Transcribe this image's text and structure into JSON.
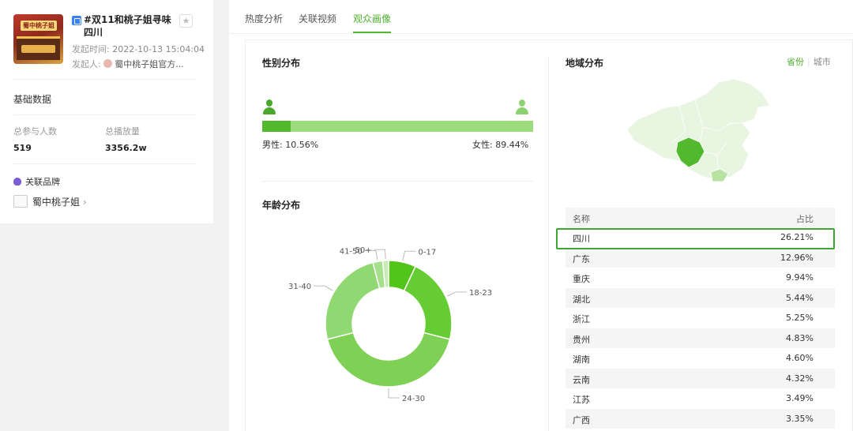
{
  "topic": {
    "cover_sign": "蜀中桃子姐",
    "title": "#双11和桃子姐寻味四川",
    "time_label": "发起时间:",
    "time_value": "2022-10-13 15:04:04",
    "owner_label": "发起人:",
    "owner_value": "蜀中桃子姐官方..."
  },
  "basic": {
    "section_title": "基础数据",
    "participants_label": "总参与人数",
    "participants_value": "519",
    "plays_label": "总播放量",
    "plays_value": "3356.2w"
  },
  "brand": {
    "section_title": "关联品牌",
    "name": "蜀中桃子姐",
    "chevron": "›"
  },
  "tabs": [
    {
      "label": "热度分析",
      "active": false
    },
    {
      "label": "关联视频",
      "active": false
    },
    {
      "label": "观众画像",
      "active": true
    }
  ],
  "gender": {
    "title": "性别分布",
    "male_label": "男性: 10.56%",
    "female_label": "女性: 89.44%",
    "male_fraction": 0.1056
  },
  "age": {
    "title": "年龄分布"
  },
  "chart_data": {
    "type": "pie",
    "categories": [
      "0-17",
      "18-23",
      "24-30",
      "31-40",
      "41-50",
      "50+"
    ],
    "values": [
      7.0,
      22.0,
      42.0,
      25.0,
      2.5,
      1.5
    ],
    "colors": [
      "#52c41a",
      "#66cc33",
      "#7fd155",
      "#8fd872",
      "#a7e08d",
      "#c6ebb3"
    ],
    "donut": true,
    "legend": "none",
    "title": ""
  },
  "region": {
    "title": "地域分布",
    "toggle_province": "省份",
    "toggle_city": "城市",
    "col_name": "名称",
    "col_pct": "占比",
    "rows": [
      {
        "name": "四川",
        "pct": "26.21%"
      },
      {
        "name": "广东",
        "pct": "12.96%"
      },
      {
        "name": "重庆",
        "pct": "9.94%"
      },
      {
        "name": "湖北",
        "pct": "5.44%"
      },
      {
        "name": "浙江",
        "pct": "5.25%"
      },
      {
        "name": "贵州",
        "pct": "4.83%"
      },
      {
        "name": "湖南",
        "pct": "4.60%"
      },
      {
        "name": "云南",
        "pct": "4.32%"
      },
      {
        "name": "江苏",
        "pct": "3.49%"
      },
      {
        "name": "广西",
        "pct": "3.35%"
      }
    ]
  },
  "colors": {
    "accent": "#52b92e",
    "highlight": "#3aa832"
  }
}
